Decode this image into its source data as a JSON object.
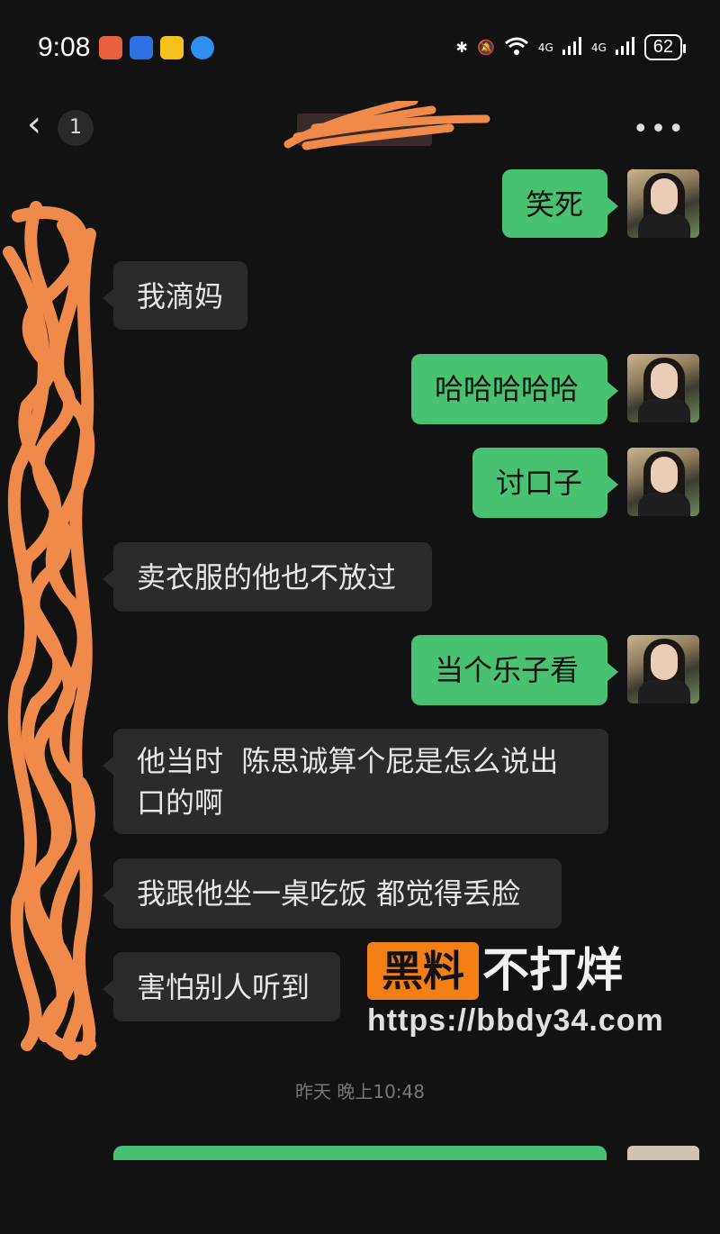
{
  "status_bar": {
    "time": "9:08",
    "battery": "62",
    "signal_1": "4G",
    "signal_2": "4G"
  },
  "nav": {
    "unread_count": "1"
  },
  "messages": [
    {
      "side": "out",
      "text": "笑死"
    },
    {
      "side": "in",
      "text": "我滴妈"
    },
    {
      "side": "out",
      "text": "哈哈哈哈哈"
    },
    {
      "side": "out",
      "text": "讨口子"
    },
    {
      "side": "in",
      "text": "卖衣服的他也不放过"
    },
    {
      "side": "out",
      "text": "当个乐子看"
    },
    {
      "side": "in",
      "text_line1": "他当时  陈思诚算个屁是怎么说出",
      "text_line2": "口的啊"
    },
    {
      "side": "in",
      "text": "我跟他坐一桌吃饭 都觉得丢脸"
    },
    {
      "side": "in",
      "text": "害怕别人听到"
    }
  ],
  "timestamp": "昨天 晚上10:48",
  "watermark": {
    "logo": "黑料",
    "tagline": "不打烊",
    "url": "https://bbdy34.com"
  },
  "colors": {
    "background": "#121212",
    "outgoing_bubble": "#48c271",
    "incoming_bubble": "#2b2b2b",
    "watermark_orange": "#f57f17",
    "scribble": "#f08a4b"
  }
}
